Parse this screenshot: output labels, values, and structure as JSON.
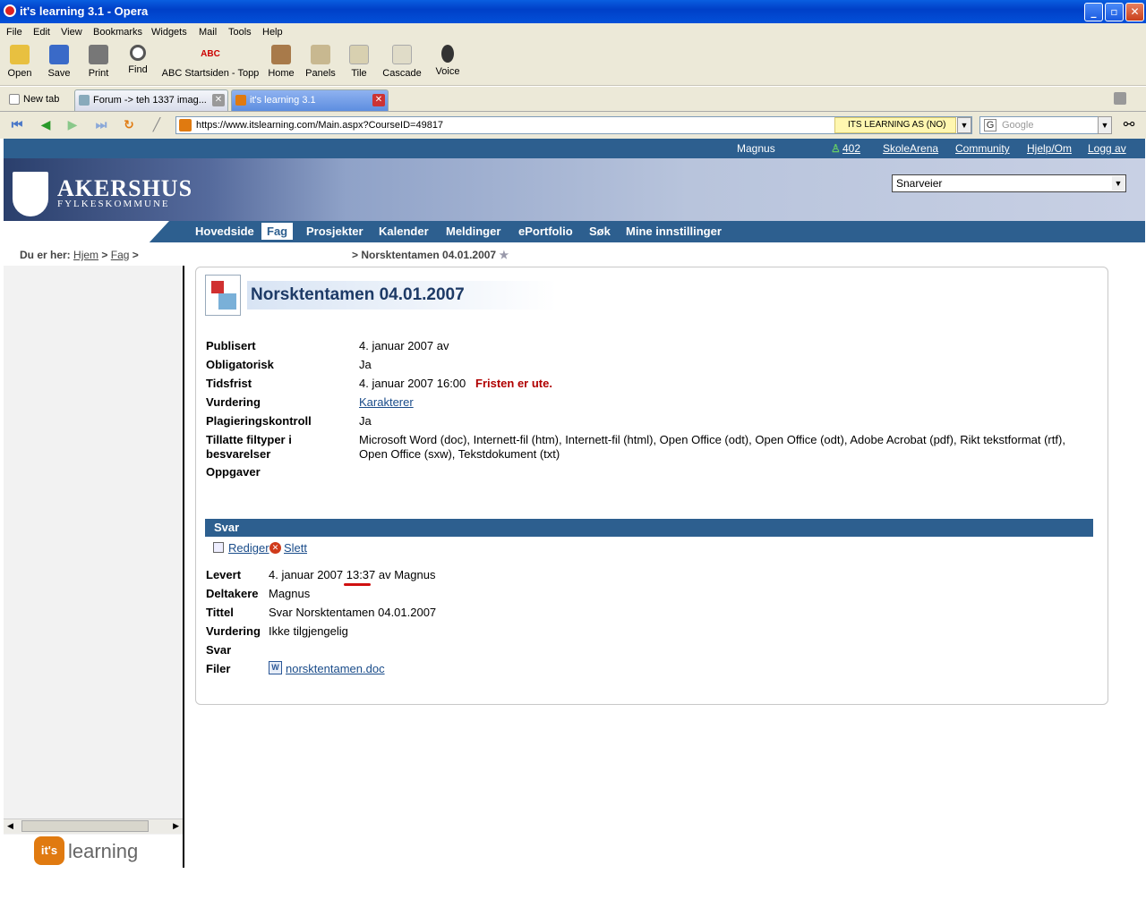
{
  "window": {
    "title": "it's learning 3.1 - Opera"
  },
  "menu": [
    "File",
    "Edit",
    "View",
    "Bookmarks",
    "Widgets",
    "Mail",
    "Tools",
    "Help"
  ],
  "toolbar": {
    "open": "Open",
    "save": "Save",
    "print": "Print",
    "find": "Find",
    "abc": "ABC Startsiden - Topp",
    "home": "Home",
    "panels": "Panels",
    "tile": "Tile",
    "cascade": "Cascade",
    "voice": "Voice"
  },
  "tabs": {
    "new": "New tab",
    "forum": "Forum -> teh 1337 imag...",
    "active": "it's learning 3.1"
  },
  "address": {
    "url": "https://www.itslearning.com/Main.aspx?CourseID=49817",
    "security": "ITS LEARNING AS (NO)",
    "search_placeholder": "Google"
  },
  "topstrip": {
    "user": "Magnus",
    "count": "402",
    "skolearena": "SkoleArena",
    "community": "Community",
    "hjelp": "Hjelp/Om",
    "logg": "Logg av"
  },
  "banner": {
    "logo_title": "AKERSHUS",
    "logo_sub": "FYLKESKOMMUNE",
    "snarveier": "Snarveier"
  },
  "nav": [
    "Hovedside",
    "Fag",
    "Prosjekter",
    "Kalender",
    "Meldinger",
    "ePortfolio",
    "Søk",
    "Mine innstillinger"
  ],
  "breadcrumb": {
    "prefix": "Du er her:",
    "hjem": "Hjem",
    "fag": "Fag",
    "sep": ">",
    "current": "> Norsktentamen 04.01.2007"
  },
  "assignment": {
    "title": "Norsktentamen 04.01.2007",
    "rows": [
      {
        "label": "Publisert",
        "value": "4. januar 2007 av"
      },
      {
        "label": "Obligatorisk",
        "value": "Ja"
      },
      {
        "label": "Tidsfrist",
        "value": "4. januar 2007 16:00",
        "note": "Fristen er ute."
      },
      {
        "label": "Vurdering",
        "value": "Karakterer"
      },
      {
        "label": "Plagieringskontroll",
        "value": "Ja"
      },
      {
        "label": "Tillatte filtyper i besvarelser",
        "value": "Microsoft Word (doc), Internett-fil (htm), Internett-fil (html), Open Office (odt), Open Office (odt), Adobe Acrobat (pdf), Rikt tekstformat (rtf), Open Office (sxw), Tekstdokument (txt)"
      },
      {
        "label": "Oppgaver",
        "value": ""
      }
    ]
  },
  "svar": {
    "header": "Svar",
    "edit": "Rediger",
    "delete": "Slett",
    "rows": [
      {
        "label": "Levert",
        "value": "4. januar 2007 13:37 av Magnus"
      },
      {
        "label": "Deltakere",
        "value": "Magnus"
      },
      {
        "label": "Tittel",
        "value": "Svar Norsktentamen 04.01.2007"
      },
      {
        "label": "Vurdering",
        "value": "Ikke tilgjengelig"
      },
      {
        "label": "Svar",
        "value": ""
      },
      {
        "label": "Filer",
        "value": "norsktentamen.doc"
      }
    ]
  },
  "footer_logo": {
    "its": "it's",
    "learning": "learning"
  },
  "colors": {
    "brand": "#2d5f8f",
    "deadline": "#b00000"
  }
}
